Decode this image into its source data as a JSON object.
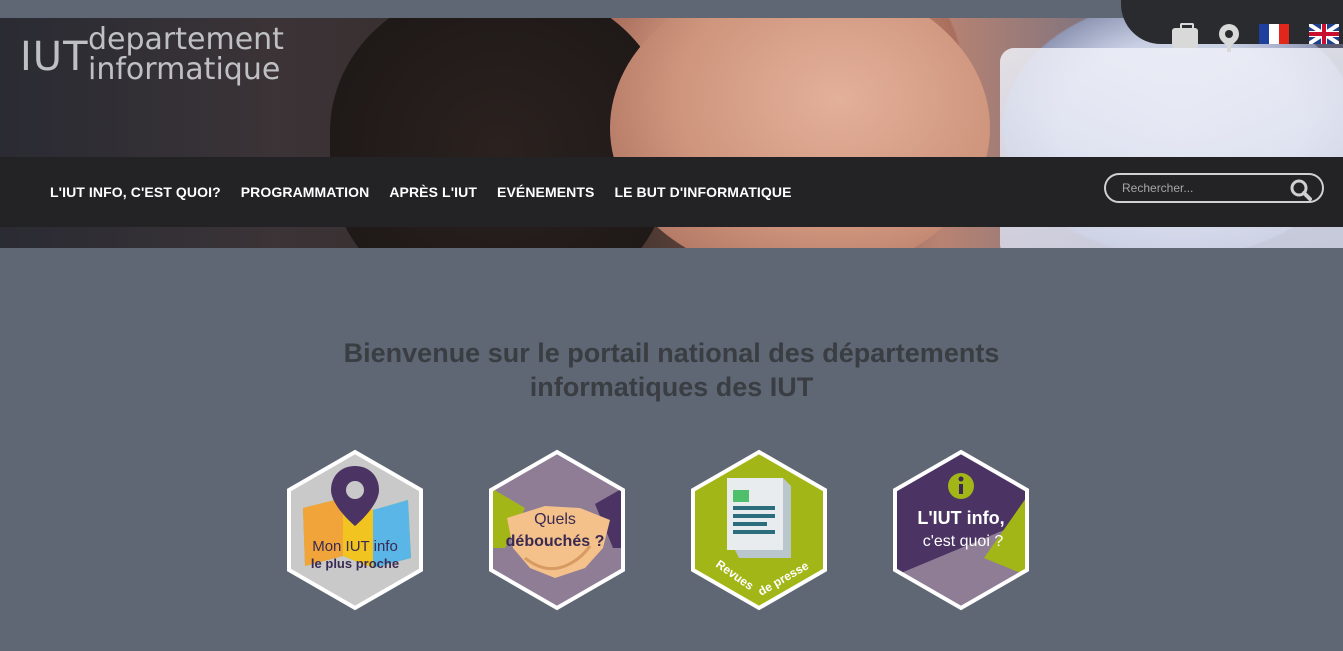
{
  "logo": {
    "iut": "IUT",
    "line1": "departement",
    "line2": "informatique"
  },
  "topbar": {
    "icons": [
      "briefcase-icon",
      "location-pin-icon",
      "flag-fr-icon",
      "flag-uk-icon"
    ]
  },
  "nav": {
    "items": [
      {
        "label": "L'IUT INFO, C'EST QUOI?"
      },
      {
        "label": "PROGRAMMATION"
      },
      {
        "label": "APRÈS L'IUT"
      },
      {
        "label": "EVÉNEMENTS"
      },
      {
        "label": "LE BUT D'INFORMATIQUE"
      }
    ],
    "search_placeholder": "Rechercher..."
  },
  "main": {
    "welcome_line1": "Bienvenue sur le portail national des départements",
    "welcome_line2": "informatiques des IUT"
  },
  "tiles": [
    {
      "line1": "Mon IUT info",
      "line2": "le plus proche",
      "icon": "map-pin-icon"
    },
    {
      "line1": "Quels",
      "line2": "débouchés ?",
      "icon": "handshake-icon"
    },
    {
      "line1": "Revues",
      "line2": "de presse",
      "icon": "document-icon"
    },
    {
      "line1": "L'IUT info,",
      "line2": "c'est quoi ?",
      "icon": "info-icon"
    }
  ],
  "colors": {
    "page_bg": "#5e6773",
    "navbar_bg": "#232326",
    "tile_green": "#a3b617",
    "tile_purple": "#4b3463",
    "tile_mauve": "#8f7d96"
  }
}
